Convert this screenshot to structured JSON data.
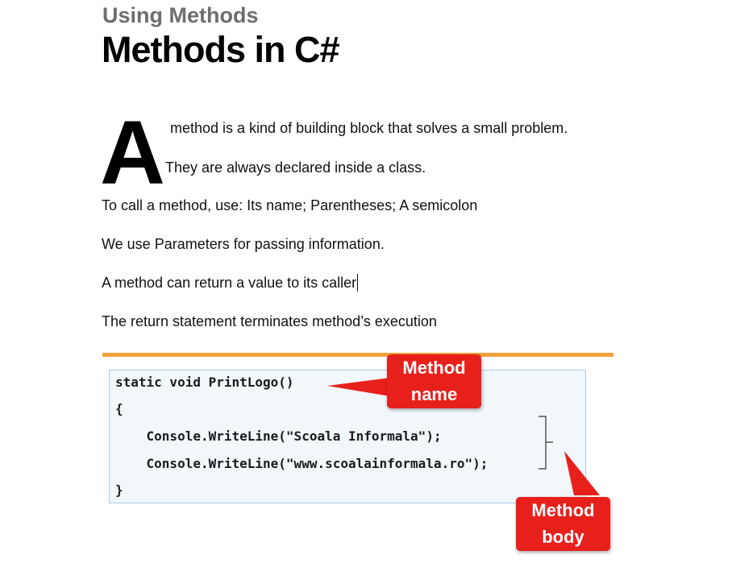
{
  "header": {
    "subtitle": "Using Methods",
    "title": "Methods in C#"
  },
  "body": {
    "drop_cap": "A",
    "lines": [
      "method is a kind of building block that solves a small problem.",
      "They are always declared inside a class.",
      "To call a method, use: Its name; Parentheses; A semicolon",
      "We use Parameters for passing information.",
      "A method can return a value to its caller",
      "The return statement terminates method’s execution"
    ]
  },
  "code": {
    "lines": [
      "static void PrintLogo()",
      "{",
      "    Console.WriteLine(\"Scoala Informala\");",
      "    Console.WriteLine(\"www.scoalainformala.ro\");",
      "}"
    ]
  },
  "callouts": {
    "method_name": [
      "Method",
      "name"
    ],
    "method_body": [
      "Method",
      "body"
    ]
  },
  "colors": {
    "accent_rule": "#f0a03c",
    "callout": "#e8201c",
    "code_background": "#f2f7fc",
    "code_border": "#a9cbe6"
  }
}
